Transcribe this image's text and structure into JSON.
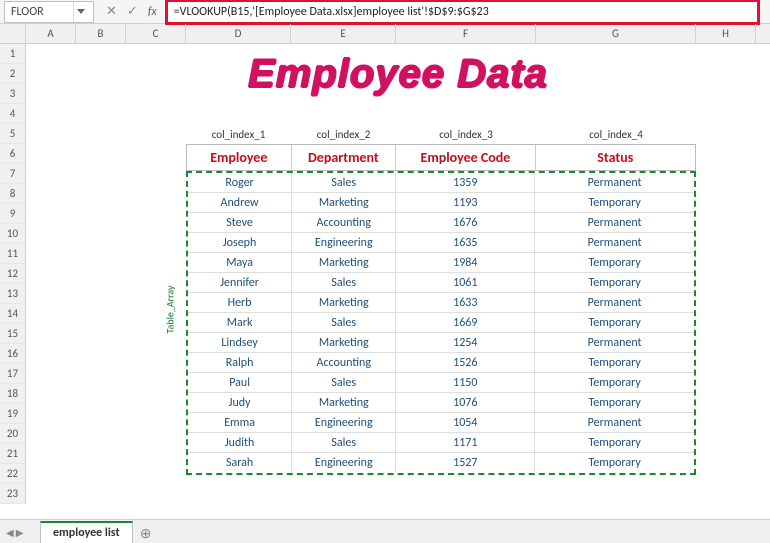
{
  "name_box": "FLOOR",
  "formula": "=VLOOKUP(B15,'[Employee Data.xlsx]employee list'!$D$9:$G$23",
  "columns": [
    "A",
    "B",
    "C",
    "D",
    "E",
    "F",
    "G",
    "H"
  ],
  "rows": [
    "1",
    "2",
    "3",
    "4",
    "5",
    "6",
    "7",
    "8",
    "9",
    "10",
    "11",
    "12",
    "13",
    "14",
    "15",
    "16",
    "17",
    "18",
    "19",
    "20",
    "21",
    "22",
    "23"
  ],
  "title": "Employee Data",
  "index_labels": [
    "col_index_1",
    "col_index_2",
    "col_index_3",
    "col_index_4"
  ],
  "array_label": "Table_Array",
  "headers": {
    "emp": "Employee",
    "dep": "Department",
    "code": "Employee Code",
    "stat": "Status"
  },
  "chart_data": {
    "type": "table",
    "columns": [
      "Employee",
      "Department",
      "Employee Code",
      "Status"
    ],
    "rows": [
      [
        "Roger",
        "Sales",
        "1359",
        "Permanent"
      ],
      [
        "Andrew",
        "Marketing",
        "1193",
        "Temporary"
      ],
      [
        "Steve",
        "Accounting",
        "1676",
        "Permanent"
      ],
      [
        "Joseph",
        "Engineering",
        "1635",
        "Permanent"
      ],
      [
        "Maya",
        "Marketing",
        "1984",
        "Temporary"
      ],
      [
        "Jennifer",
        "Sales",
        "1061",
        "Temporary"
      ],
      [
        "Herb",
        "Marketing",
        "1633",
        "Permanent"
      ],
      [
        "Mark",
        "Sales",
        "1669",
        "Temporary"
      ],
      [
        "Lindsey",
        "Marketing",
        "1254",
        "Permanent"
      ],
      [
        "Ralph",
        "Accounting",
        "1526",
        "Temporary"
      ],
      [
        "Paul",
        "Sales",
        "1150",
        "Temporary"
      ],
      [
        "Judy",
        "Marketing",
        "1076",
        "Temporary"
      ],
      [
        "Emma",
        "Engineering",
        "1054",
        "Permanent"
      ],
      [
        "Judith",
        "Sales",
        "1171",
        "Temporary"
      ],
      [
        "Sarah",
        "Engineering",
        "1527",
        "Temporary"
      ]
    ]
  },
  "sheet_tab": "employee list",
  "icons": {
    "cancel": "✕",
    "enter": "✓",
    "fx": "fx",
    "add": "⊕",
    "nav_left": "◀",
    "nav_right": "▶"
  }
}
